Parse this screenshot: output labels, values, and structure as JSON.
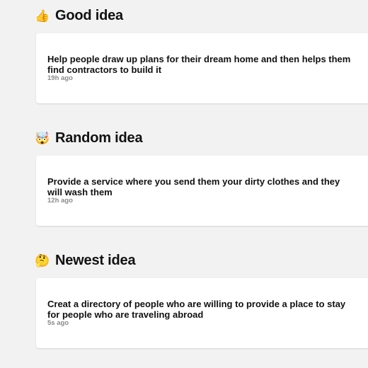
{
  "sections": [
    {
      "icon": "👍",
      "icon_name": "thumbs-up-icon",
      "title": "Good idea",
      "idea": "Help people draw up plans for their dream home and then helps them find contractors to build it",
      "time": "19h ago"
    },
    {
      "icon": "🤯",
      "icon_name": "exploding-head-icon",
      "title": "Random idea",
      "idea": "Provide a service where you send them your dirty clothes and they will wash them",
      "time": "12h ago"
    },
    {
      "icon": "🤔",
      "icon_name": "thinking-face-icon",
      "title": "Newest idea",
      "idea": "Creat a directory of people who are willing to provide a place to stay for people who are traveling abroad",
      "time": "5s ago"
    }
  ]
}
